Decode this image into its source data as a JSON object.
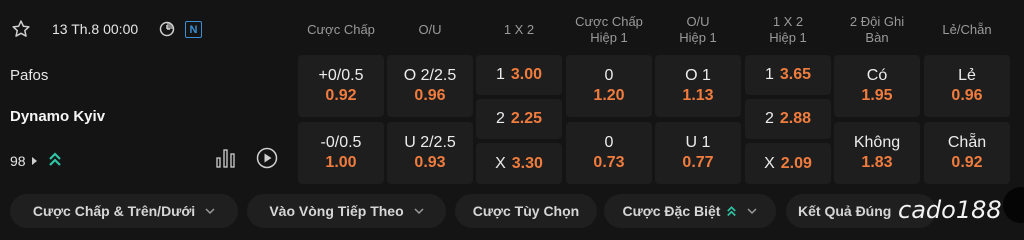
{
  "match": {
    "date_time": "13 Th.8 00:00",
    "badge": "N",
    "home_team": "Pafos",
    "away_team": "Dynamo Kyiv",
    "market_count": "98",
    "icons": {
      "favorite": "star-icon",
      "timer": "clock-icon",
      "stats": "bar-chart-icon",
      "video": "play-icon",
      "expand": "caret-right-icon",
      "trend": "double-chevron-up-icon"
    }
  },
  "headers": [
    {
      "line1": "Cược Chấp",
      "line2": ""
    },
    {
      "line1": "O/U",
      "line2": ""
    },
    {
      "line1": "1 X 2",
      "line2": ""
    },
    {
      "line1": "Cược Chấp",
      "line2": "Hiệp 1"
    },
    {
      "line1": "O/U",
      "line2": "Hiệp 1"
    },
    {
      "line1": "1 X 2",
      "line2": "Hiệp 1"
    },
    {
      "line1": "2 Đội Ghi",
      "line2": "Bàn"
    },
    {
      "line1": "Lẻ/Chẵn",
      "line2": ""
    }
  ],
  "odds": {
    "handicap": [
      {
        "label": "+0/0.5",
        "odd": "0.92"
      },
      {
        "label": "-0/0.5",
        "odd": "1.00"
      }
    ],
    "over_under": [
      {
        "label": "O 2/2.5",
        "odd": "0.96"
      },
      {
        "label": "U 2/2.5",
        "odd": "0.93"
      }
    ],
    "one_x_two": [
      {
        "label": "1",
        "odd": "3.00"
      },
      {
        "label": "2",
        "odd": "2.25"
      },
      {
        "label": "X",
        "odd": "3.30"
      }
    ],
    "handicap_h1": [
      {
        "label": "0",
        "odd": "1.20"
      },
      {
        "label": "0",
        "odd": "0.73"
      }
    ],
    "over_under_h1": [
      {
        "label": "O 1",
        "odd": "1.13"
      },
      {
        "label": "U 1",
        "odd": "0.77"
      }
    ],
    "one_x_two_h1": [
      {
        "label": "1",
        "odd": "3.65"
      },
      {
        "label": "2",
        "odd": "2.88"
      },
      {
        "label": "X",
        "odd": "2.09"
      }
    ],
    "both_teams_score": [
      {
        "label": "Có",
        "odd": "1.95"
      },
      {
        "label": "Không",
        "odd": "1.83"
      }
    ],
    "odd_even": [
      {
        "label": "Lẻ",
        "odd": "0.96"
      },
      {
        "label": "Chẵn",
        "odd": "0.92"
      }
    ]
  },
  "filters": [
    {
      "label": "Cược Chấp & Trên/Dưới",
      "trend": false
    },
    {
      "label": "Vào Vòng Tiếp Theo",
      "trend": false
    },
    {
      "label": "Cược Tùy Chọn",
      "trend": false
    },
    {
      "label": "Cược Đặc Biệt",
      "trend": true
    },
    {
      "label": "Kết Quả Đúng",
      "trend": false
    }
  ],
  "watermark": "cado188",
  "colors": {
    "background": "#141414",
    "cell": "#1e1e1e",
    "odd": "#f07c3e",
    "accent_teal": "#2ec4a6",
    "badge": "#3a8fd8"
  }
}
